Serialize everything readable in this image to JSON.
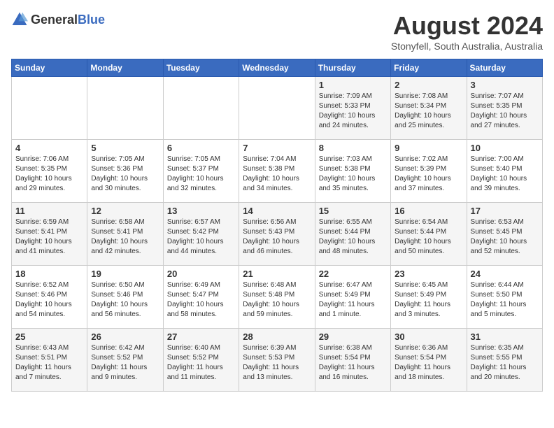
{
  "header": {
    "logo_general": "General",
    "logo_blue": "Blue",
    "month_year": "August 2024",
    "location": "Stonyfell, South Australia, Australia"
  },
  "weekdays": [
    "Sunday",
    "Monday",
    "Tuesday",
    "Wednesday",
    "Thursday",
    "Friday",
    "Saturday"
  ],
  "weeks": [
    [
      {
        "day": "",
        "info": ""
      },
      {
        "day": "",
        "info": ""
      },
      {
        "day": "",
        "info": ""
      },
      {
        "day": "",
        "info": ""
      },
      {
        "day": "1",
        "info": "Sunrise: 7:09 AM\nSunset: 5:33 PM\nDaylight: 10 hours\nand 24 minutes."
      },
      {
        "day": "2",
        "info": "Sunrise: 7:08 AM\nSunset: 5:34 PM\nDaylight: 10 hours\nand 25 minutes."
      },
      {
        "day": "3",
        "info": "Sunrise: 7:07 AM\nSunset: 5:35 PM\nDaylight: 10 hours\nand 27 minutes."
      }
    ],
    [
      {
        "day": "4",
        "info": "Sunrise: 7:06 AM\nSunset: 5:35 PM\nDaylight: 10 hours\nand 29 minutes."
      },
      {
        "day": "5",
        "info": "Sunrise: 7:05 AM\nSunset: 5:36 PM\nDaylight: 10 hours\nand 30 minutes."
      },
      {
        "day": "6",
        "info": "Sunrise: 7:05 AM\nSunset: 5:37 PM\nDaylight: 10 hours\nand 32 minutes."
      },
      {
        "day": "7",
        "info": "Sunrise: 7:04 AM\nSunset: 5:38 PM\nDaylight: 10 hours\nand 34 minutes."
      },
      {
        "day": "8",
        "info": "Sunrise: 7:03 AM\nSunset: 5:38 PM\nDaylight: 10 hours\nand 35 minutes."
      },
      {
        "day": "9",
        "info": "Sunrise: 7:02 AM\nSunset: 5:39 PM\nDaylight: 10 hours\nand 37 minutes."
      },
      {
        "day": "10",
        "info": "Sunrise: 7:00 AM\nSunset: 5:40 PM\nDaylight: 10 hours\nand 39 minutes."
      }
    ],
    [
      {
        "day": "11",
        "info": "Sunrise: 6:59 AM\nSunset: 5:41 PM\nDaylight: 10 hours\nand 41 minutes."
      },
      {
        "day": "12",
        "info": "Sunrise: 6:58 AM\nSunset: 5:41 PM\nDaylight: 10 hours\nand 42 minutes."
      },
      {
        "day": "13",
        "info": "Sunrise: 6:57 AM\nSunset: 5:42 PM\nDaylight: 10 hours\nand 44 minutes."
      },
      {
        "day": "14",
        "info": "Sunrise: 6:56 AM\nSunset: 5:43 PM\nDaylight: 10 hours\nand 46 minutes."
      },
      {
        "day": "15",
        "info": "Sunrise: 6:55 AM\nSunset: 5:44 PM\nDaylight: 10 hours\nand 48 minutes."
      },
      {
        "day": "16",
        "info": "Sunrise: 6:54 AM\nSunset: 5:44 PM\nDaylight: 10 hours\nand 50 minutes."
      },
      {
        "day": "17",
        "info": "Sunrise: 6:53 AM\nSunset: 5:45 PM\nDaylight: 10 hours\nand 52 minutes."
      }
    ],
    [
      {
        "day": "18",
        "info": "Sunrise: 6:52 AM\nSunset: 5:46 PM\nDaylight: 10 hours\nand 54 minutes."
      },
      {
        "day": "19",
        "info": "Sunrise: 6:50 AM\nSunset: 5:46 PM\nDaylight: 10 hours\nand 56 minutes."
      },
      {
        "day": "20",
        "info": "Sunrise: 6:49 AM\nSunset: 5:47 PM\nDaylight: 10 hours\nand 58 minutes."
      },
      {
        "day": "21",
        "info": "Sunrise: 6:48 AM\nSunset: 5:48 PM\nDaylight: 10 hours\nand 59 minutes."
      },
      {
        "day": "22",
        "info": "Sunrise: 6:47 AM\nSunset: 5:49 PM\nDaylight: 11 hours\nand 1 minute."
      },
      {
        "day": "23",
        "info": "Sunrise: 6:45 AM\nSunset: 5:49 PM\nDaylight: 11 hours\nand 3 minutes."
      },
      {
        "day": "24",
        "info": "Sunrise: 6:44 AM\nSunset: 5:50 PM\nDaylight: 11 hours\nand 5 minutes."
      }
    ],
    [
      {
        "day": "25",
        "info": "Sunrise: 6:43 AM\nSunset: 5:51 PM\nDaylight: 11 hours\nand 7 minutes."
      },
      {
        "day": "26",
        "info": "Sunrise: 6:42 AM\nSunset: 5:52 PM\nDaylight: 11 hours\nand 9 minutes."
      },
      {
        "day": "27",
        "info": "Sunrise: 6:40 AM\nSunset: 5:52 PM\nDaylight: 11 hours\nand 11 minutes."
      },
      {
        "day": "28",
        "info": "Sunrise: 6:39 AM\nSunset: 5:53 PM\nDaylight: 11 hours\nand 13 minutes."
      },
      {
        "day": "29",
        "info": "Sunrise: 6:38 AM\nSunset: 5:54 PM\nDaylight: 11 hours\nand 16 minutes."
      },
      {
        "day": "30",
        "info": "Sunrise: 6:36 AM\nSunset: 5:54 PM\nDaylight: 11 hours\nand 18 minutes."
      },
      {
        "day": "31",
        "info": "Sunrise: 6:35 AM\nSunset: 5:55 PM\nDaylight: 11 hours\nand 20 minutes."
      }
    ]
  ]
}
